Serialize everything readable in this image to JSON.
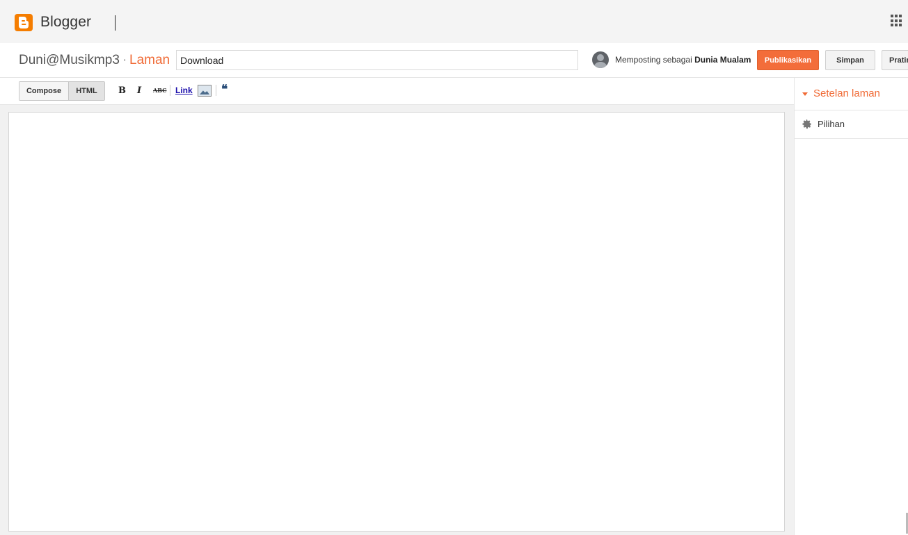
{
  "header": {
    "brand": "Blogger",
    "logo_icon": "blogger-logo-icon",
    "apps_icon": "apps-grid-icon"
  },
  "title_row": {
    "blog_name": "Duni@Musikmp3",
    "separator": "·",
    "section": "Laman",
    "page_title_value": "Download",
    "posting_as_prefix": "Memposting sebagai",
    "posting_as_user": "Dunia Mualam",
    "publish_label": "Publikasikan",
    "save_label": "Simpan",
    "preview_label": "Pratin"
  },
  "toolbar": {
    "compose_label": "Compose",
    "html_label": "HTML",
    "bold_label": "B",
    "italic_label": "I",
    "strike_label": "ABC",
    "link_label": "Link",
    "quote_label": "❝",
    "active_mode": "HTML"
  },
  "editor": {
    "content": ""
  },
  "sidebar": {
    "title": "Setelan laman",
    "items": [
      {
        "label": "Pilihan",
        "icon": "gear-icon"
      }
    ]
  },
  "colors": {
    "accent": "#f06a35",
    "publish_button": "#f36d3a",
    "topbar_bg": "#f4f4f4"
  }
}
